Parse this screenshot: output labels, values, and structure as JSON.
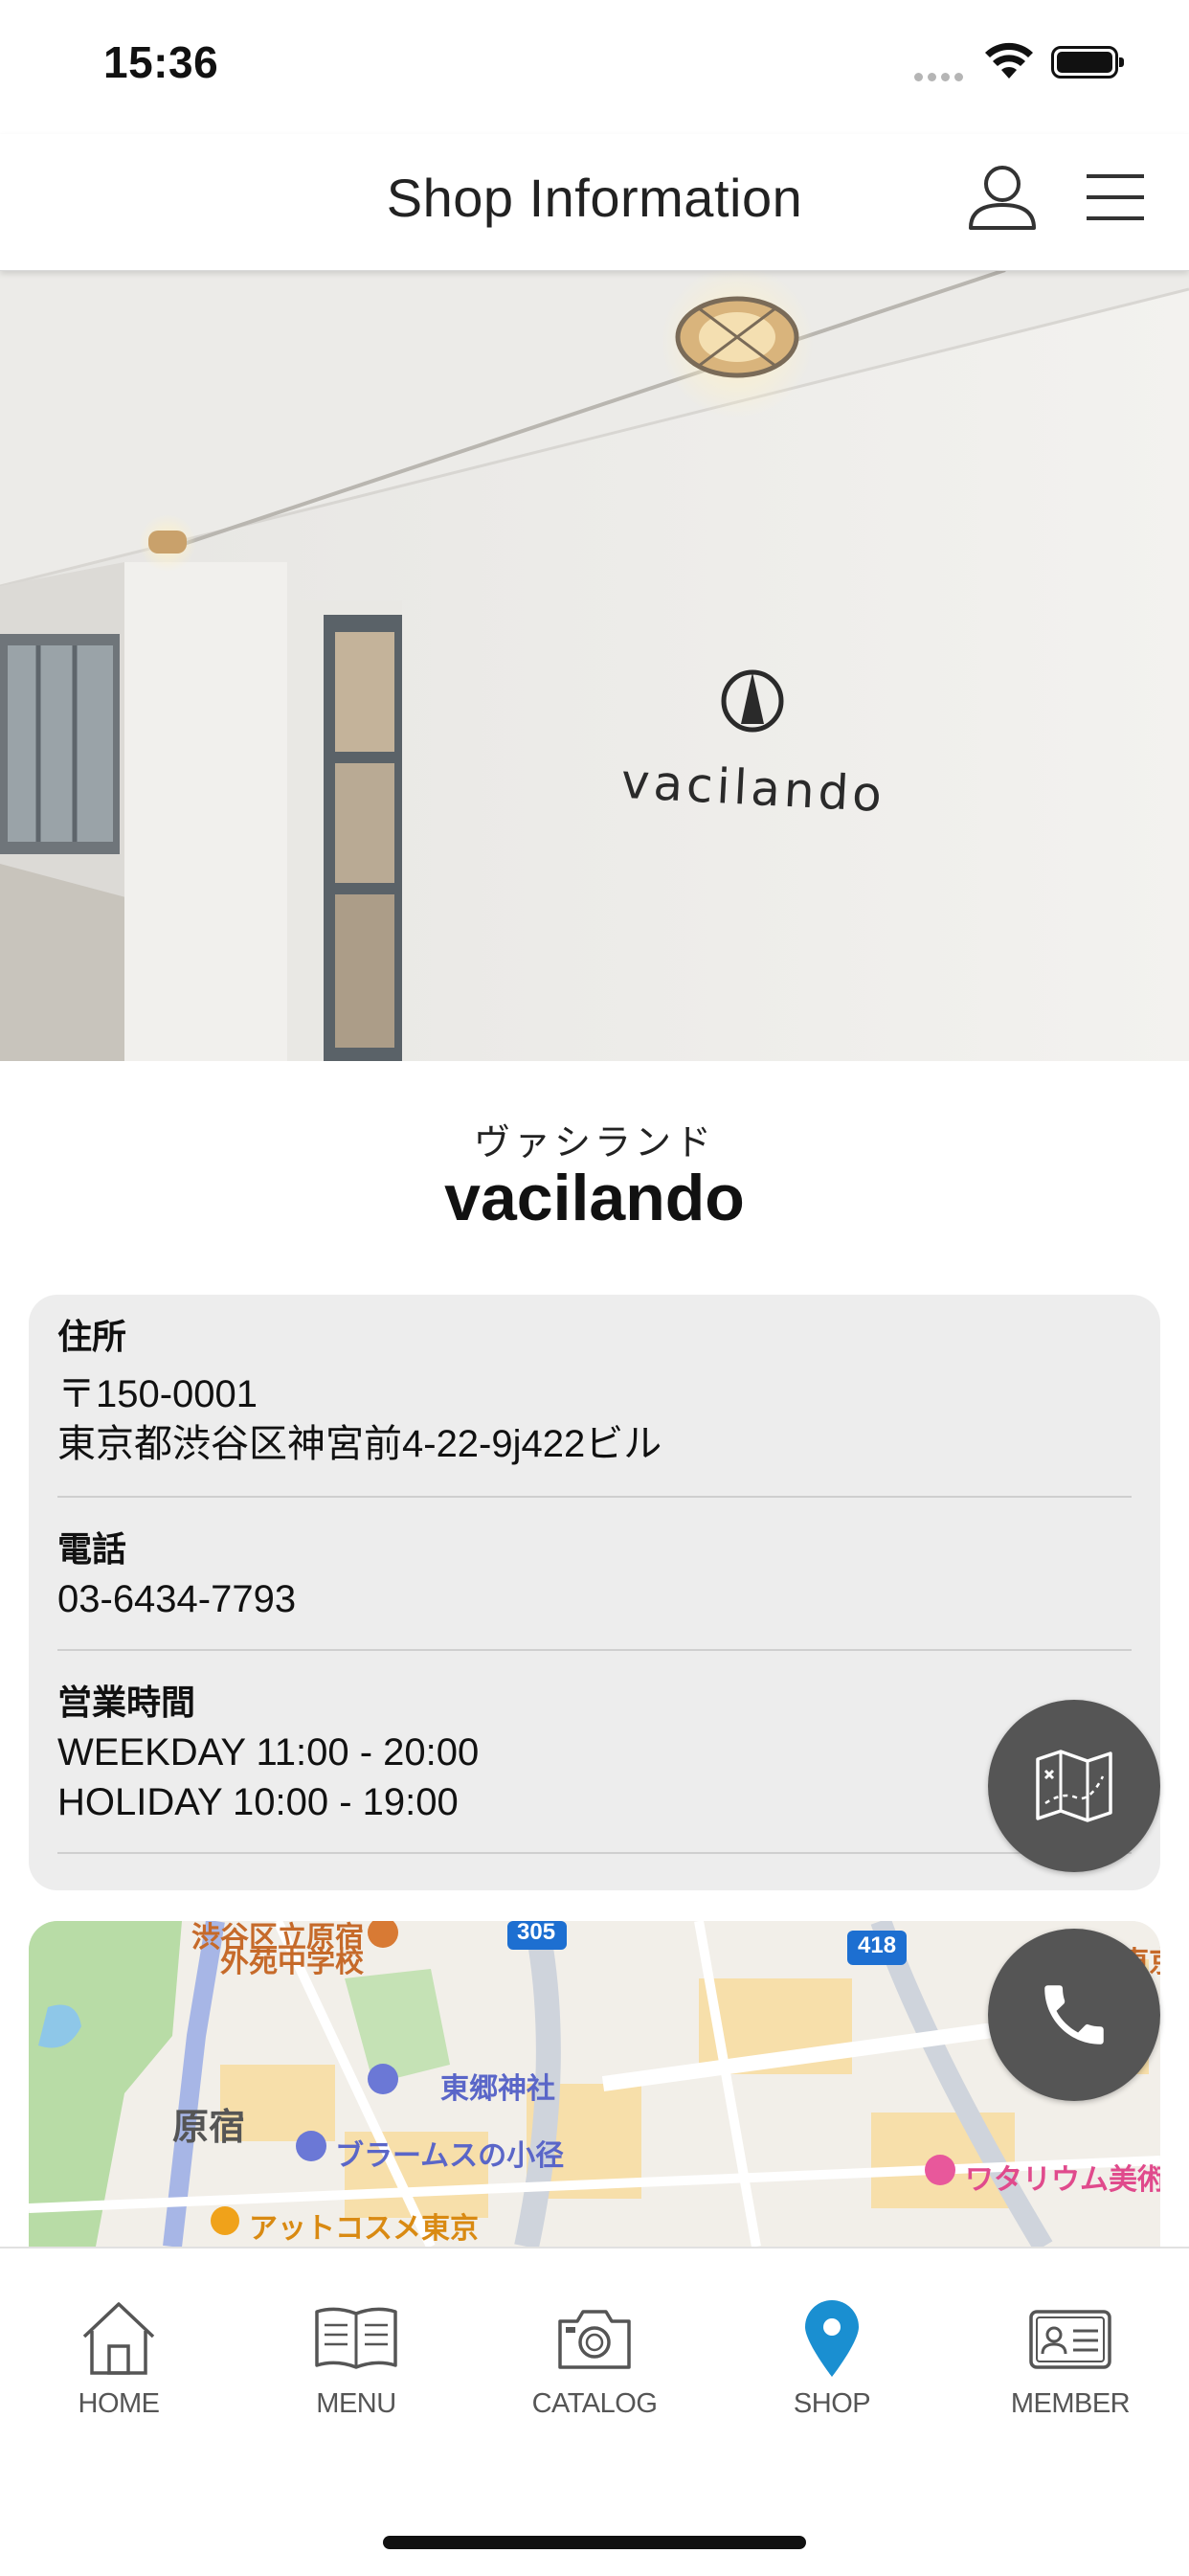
{
  "status_bar": {
    "time": "15:36"
  },
  "header": {
    "title": "Shop Information"
  },
  "hero": {
    "sign_text": "vacilando"
  },
  "shop": {
    "name_kana": "ヴァシランド",
    "name": "vacilando"
  },
  "info": {
    "address_label": "住所",
    "address_postal": "〒150-0001",
    "address_line": "東京都渋谷区神宮前4-22-9j422ビル",
    "phone_label": "電話",
    "phone": "03-6434-7793",
    "hours_label": "営業時間",
    "hours_weekday": "WEEKDAY 11:00 - 20:00",
    "hours_holiday": "HOLIDAY 10:00 - 19:00"
  },
  "map": {
    "labels": {
      "school_1": "渋谷区立原宿",
      "school_2": "外苑中学校",
      "harajuku": "原宿",
      "shrine": "東郷神社",
      "brahms": "ブラームスの小径",
      "atcosme": "アットコスメ東京",
      "watari": "ワタリウム美術",
      "east": "東京",
      "route_305": "305",
      "route_418": "418"
    }
  },
  "nav": {
    "items": [
      {
        "label": "HOME",
        "icon": "home-icon"
      },
      {
        "label": "MENU",
        "icon": "book-icon"
      },
      {
        "label": "CATALOG",
        "icon": "camera-icon"
      },
      {
        "label": "SHOP",
        "icon": "location-pin-icon"
      },
      {
        "label": "MEMBER",
        "icon": "member-card-icon"
      }
    ],
    "active_color": "#1a8fd1"
  },
  "colors": {
    "fab": "#555555",
    "card": "#ededed"
  }
}
